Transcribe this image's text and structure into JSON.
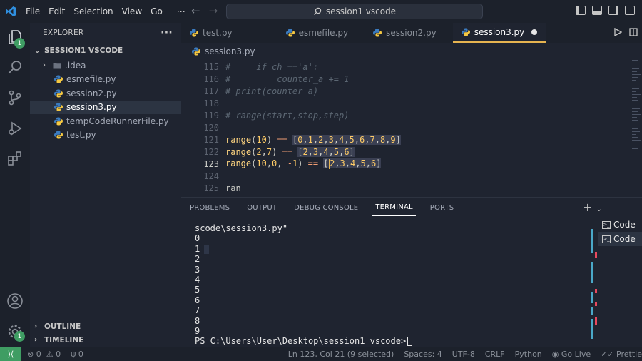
{
  "title_bar": {
    "menu": [
      "File",
      "Edit",
      "Selection",
      "View",
      "Go",
      "⋯"
    ],
    "command_center": "session1 vscode"
  },
  "activity_badges": {
    "explorer": "1",
    "manage": "1"
  },
  "sidebar": {
    "title": "EXPLORER",
    "more": "···",
    "section": "SESSION1 VSCODE",
    "items": [
      {
        "label": ".idea",
        "type": "folder"
      },
      {
        "label": "esmefile.py",
        "type": "python"
      },
      {
        "label": "session2.py",
        "type": "python"
      },
      {
        "label": "session3.py",
        "type": "python",
        "active": true
      },
      {
        "label": "tempCodeRunnerFile.py",
        "type": "python"
      },
      {
        "label": "test.py",
        "type": "python"
      }
    ],
    "outline": "OUTLINE",
    "timeline": "TIMELINE"
  },
  "tabs": [
    {
      "label": "test.py"
    },
    {
      "label": "esmefile.py"
    },
    {
      "label": "session2.py"
    },
    {
      "label": "session3.py",
      "active": true,
      "modified": true
    }
  ],
  "breadcrumb": "session3.py",
  "editor": {
    "lines": [
      {
        "n": "115",
        "text": "#     if ch =='a':"
      },
      {
        "n": "116",
        "text": "#         counter_a += 1"
      },
      {
        "n": "117",
        "text": "# print(counter_a)"
      },
      {
        "n": "118",
        "text": ""
      },
      {
        "n": "119",
        "text": "# range(start,stop,step)"
      },
      {
        "n": "120",
        "text": ""
      },
      {
        "n": "121",
        "text": "range(10) == [0,1,2,3,4,5,6,7,8,9]"
      },
      {
        "n": "122",
        "text": "range(2,7) == [2,3,4,5,6]"
      },
      {
        "n": "123",
        "text": "range(10,0, -1) == [2,3,4,5,6]"
      },
      {
        "n": "124",
        "text": ""
      },
      {
        "n": "125",
        "text": "ran"
      }
    ]
  },
  "panel": {
    "tabs": [
      "PROBLEMS",
      "OUTPUT",
      "DEBUG CONSOLE",
      "TERMINAL",
      "PORTS"
    ],
    "active_tab": "TERMINAL",
    "add": "+",
    "terminal_lines": [
      "scode\\session3.py\"",
      "0",
      "1",
      "2",
      "3",
      "4",
      "5",
      "6",
      "7",
      "8",
      "9"
    ],
    "prompt": "PS C:\\Users\\User\\Desktop\\session1 vscode>",
    "terminals": [
      "Code",
      "Code"
    ]
  },
  "status_bar": {
    "errors": "0",
    "warnings": "0",
    "ports": "0",
    "position": "Ln 123, Col 21 (9 selected)",
    "spaces": "Spaces: 4",
    "encoding": "UTF-8",
    "eol": "CRLF",
    "language": "Python",
    "go_live": "Go Live",
    "prettier": "Prettie"
  },
  "colors": {
    "accent": "#e6b450",
    "badge": "#3f9d63",
    "background": "#1f2430"
  }
}
